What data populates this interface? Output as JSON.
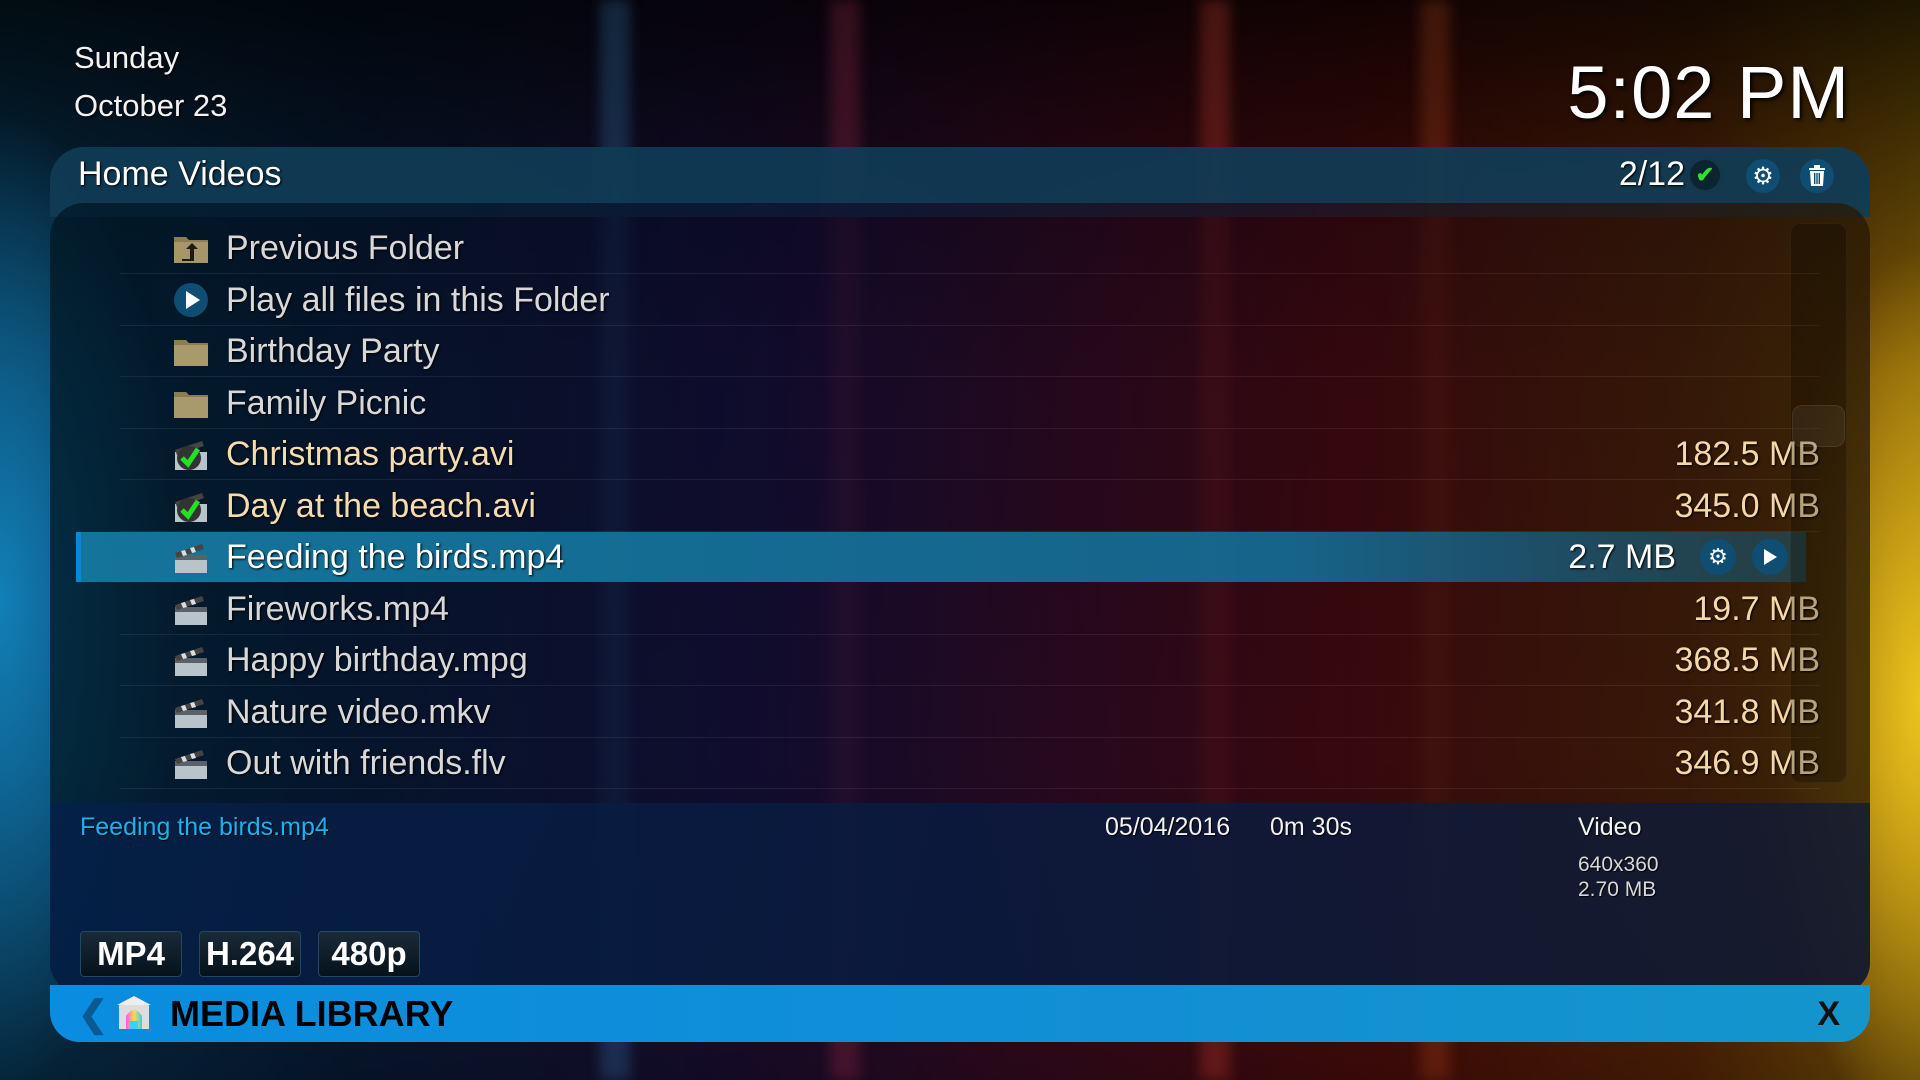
{
  "datetime": {
    "day": "Sunday",
    "date": "October 23",
    "time": "5:02 PM"
  },
  "header": {
    "title": "Home Videos",
    "count": "2/12",
    "icons": [
      "check-icon",
      "gear-icon",
      "trash-icon"
    ]
  },
  "list": {
    "items": [
      {
        "label": "Previous Folder",
        "size": "",
        "icon": "folder-up-icon",
        "watched": false
      },
      {
        "label": "Play all files in this Folder",
        "size": "",
        "icon": "play-icon",
        "watched": false
      },
      {
        "label": "Birthday Party",
        "size": "",
        "icon": "folder-icon",
        "watched": false
      },
      {
        "label": "Family Picnic",
        "size": "",
        "icon": "folder-icon",
        "watched": false
      },
      {
        "label": "Christmas party.avi",
        "size": "182.5 MB",
        "icon": "video-watched-icon",
        "watched": true
      },
      {
        "label": "Day at the beach.avi",
        "size": "345.0 MB",
        "icon": "video-watched-icon",
        "watched": true
      },
      {
        "label": "Feeding the birds.mp4",
        "size": "2.7 MB",
        "icon": "clapperboard-icon",
        "watched": false,
        "selected": true
      },
      {
        "label": "Fireworks.mp4",
        "size": "19.7 MB",
        "icon": "clapperboard-icon",
        "watched": false
      },
      {
        "label": "Happy birthday.mpg",
        "size": "368.5 MB",
        "icon": "clapperboard-icon",
        "watched": false
      },
      {
        "label": "Nature video.mkv",
        "size": "341.8 MB",
        "icon": "clapperboard-icon",
        "watched": false
      },
      {
        "label": "Out with friends.flv",
        "size": "346.9 MB",
        "icon": "clapperboard-icon",
        "watched": false
      }
    ],
    "scroll_position_fraction": 0.35
  },
  "info": {
    "title": "Feeding the birds.mp4",
    "date": "05/04/2016",
    "duration": "0m 30s",
    "type": "Video",
    "resolution": "640x360",
    "filesize": "2.70 MB",
    "badges": [
      "MP4",
      "H.264",
      "480p"
    ]
  },
  "footer": {
    "back_label": "❮",
    "title": "MEDIA LIBRARY",
    "close_label": "X"
  },
  "colors": {
    "accent": "#0a8de0",
    "info_title": "#16b4f0",
    "watched_text": "#f5dcb0",
    "check_green": "#2ee12e"
  }
}
